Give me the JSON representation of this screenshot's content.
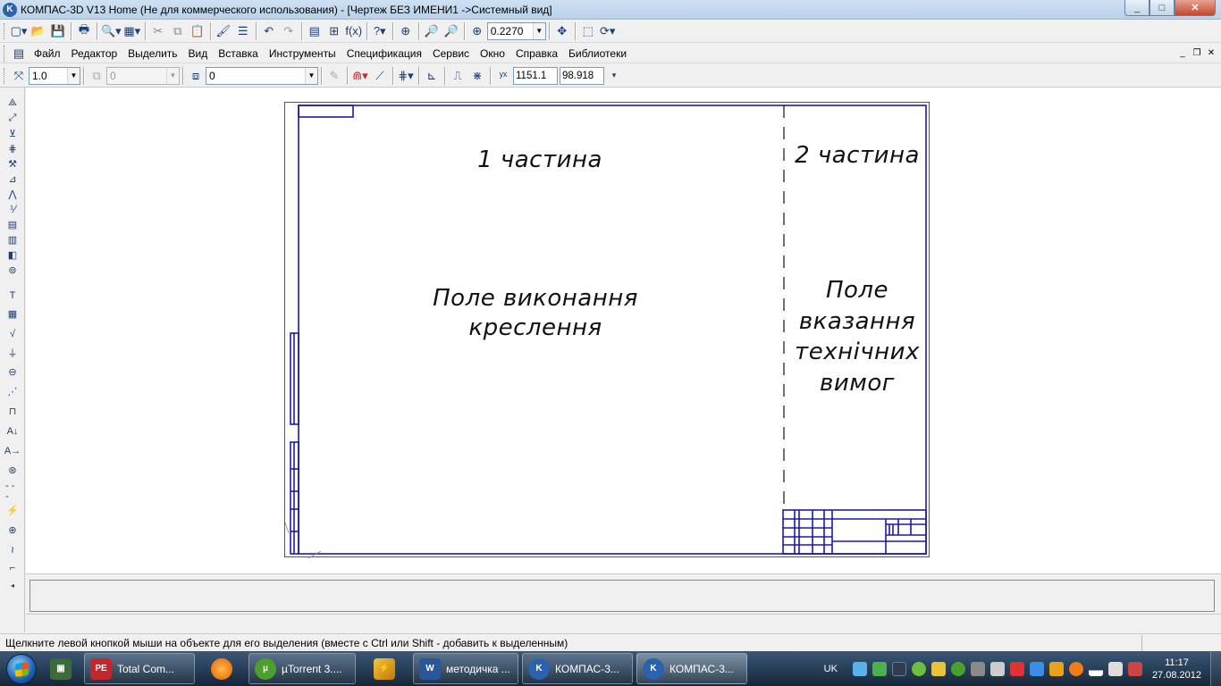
{
  "window": {
    "title": "КОМПАС-3D V13 Home (Не для коммерческого использования) - [Чертеж БЕЗ ИМЕНИ1 ->Системный вид]",
    "min": "_",
    "max": "□",
    "close": "✕"
  },
  "toolbar": {
    "zoom_value": "0.2270"
  },
  "menu": {
    "items": [
      "Файл",
      "Редактор",
      "Выделить",
      "Вид",
      "Вставка",
      "Инструменты",
      "Спецификация",
      "Сервис",
      "Окно",
      "Справка",
      "Библиотеки"
    ]
  },
  "props_toolbar": {
    "scale_value": "1.0",
    "layer_value": "0",
    "style_value": "0",
    "coord_x": "1151.1",
    "coord_y": "98.918"
  },
  "drawing": {
    "part1_title": "1 частина",
    "part2_title": "2 частина",
    "field1_line1": "Поле виконання",
    "field1_line2": "креслення",
    "field2_line1": "Поле",
    "field2_line2": "вказання",
    "field2_line3": "технічних",
    "field2_line4": "вимог"
  },
  "status": {
    "message": "Щелкните левой кнопкой мыши на объекте для его выделения (вместе с Ctrl или Shift - добавить к выделенным)"
  },
  "taskbar": {
    "apps": [
      {
        "label": "Total Com...",
        "icon": "total-commander-icon",
        "color": "#c0282d"
      },
      {
        "label": "",
        "icon": "firefox-icon",
        "color": "#e66000"
      },
      {
        "label": "µTorrent 3....",
        "icon": "utorrent-icon",
        "color": "#4aa02c"
      },
      {
        "label": "",
        "icon": "winamp-icon",
        "color": "#e8a31b"
      },
      {
        "label": "методичка ...",
        "icon": "word-icon",
        "color": "#2b579a"
      },
      {
        "label": "КОМПАС-3...",
        "icon": "kompas-icon",
        "color": "#2a62b0"
      },
      {
        "label": "КОМПАС-3...",
        "icon": "kompas-icon",
        "color": "#2a62b0"
      }
    ],
    "lang": "UK",
    "time": "11:17",
    "date": "27.08.2012"
  },
  "colors": {
    "drawing_line": "#1a1aa8",
    "taskbar": "#1d3350"
  }
}
